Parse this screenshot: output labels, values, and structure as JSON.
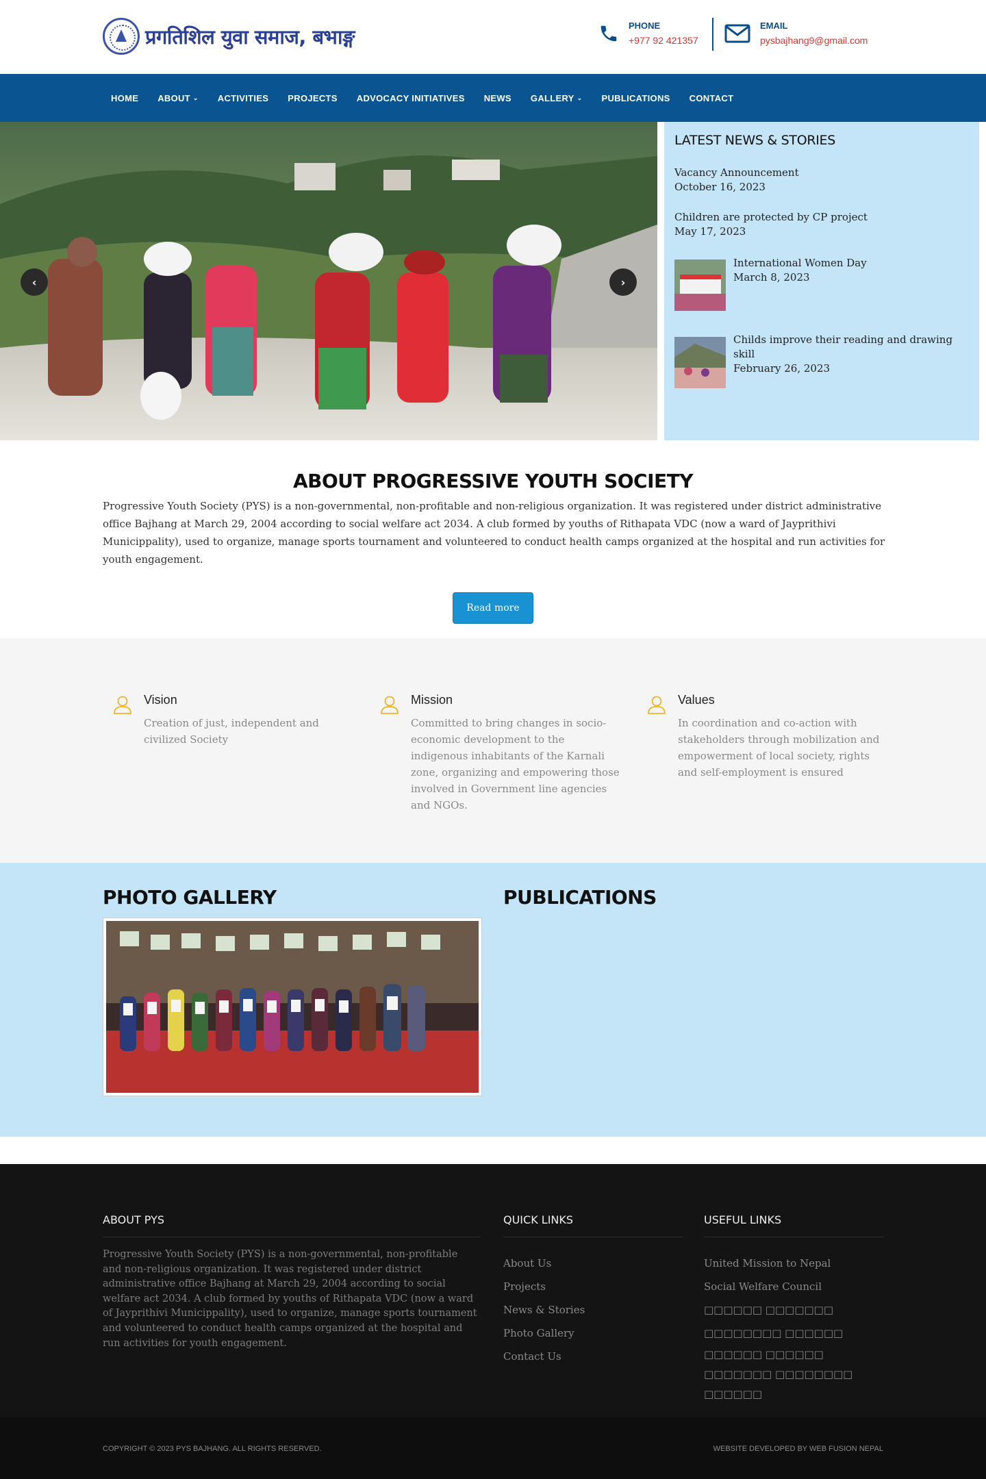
{
  "header": {
    "logo_text": "प्रगतिशिल युवा समाज, बभाङ्ग",
    "phone_label": "PHONE",
    "phone_value": "+977 92 421357",
    "email_label": "EMAIL",
    "email_value": "pysbajhang9@gmail.com"
  },
  "nav": {
    "items": [
      {
        "label": "HOME"
      },
      {
        "label": "ABOUT"
      },
      {
        "label": "ACTIVITIES"
      },
      {
        "label": "PROJECTS"
      },
      {
        "label": "ADVOCACY INITIATIVES"
      },
      {
        "label": "NEWS"
      },
      {
        "label": "GALLERY"
      },
      {
        "label": "PUBLICATIONS"
      },
      {
        "label": "CONTACT"
      }
    ]
  },
  "news": {
    "title": "LATEST NEWS & STORIES",
    "items": [
      {
        "title": "Vacancy Announcement",
        "date": "October 16, 2023"
      },
      {
        "title": "Children are protected by CP project",
        "date": "May 17, 2023"
      },
      {
        "title": "International Women Day",
        "date": "March 8, 2023"
      },
      {
        "title": "Childs improve their reading and drawing skill",
        "date": "February 26, 2023"
      }
    ]
  },
  "about": {
    "title": "ABOUT PROGRESSIVE YOUTH SOCIETY",
    "text": "Progressive Youth Society (PYS) is a non-governmental, non-profitable and non-religious organization. It was registered under district administrative office Bajhang at March 29, 2004 according to social welfare act 2034. A club formed by youths of Rithapata VDC (now a ward of Jayprithivi Municippality), used to organize, manage sports tournament and volunteered to conduct health camps organized at the hospital and run activities for youth engagement.",
    "button": "Read more"
  },
  "vmv": [
    {
      "title": "Vision",
      "text": "Creation of just, independent and civilized Society"
    },
    {
      "title": "Mission",
      "text": "Committed to bring changes in socio-economic development to the indigenous inhabitants of the Karnali zone, organizing and empowering those involved in Government line agencies and NGOs."
    },
    {
      "title": "Values",
      "text": "In coordination and co-action with stakeholders through mobilization and empowerment of local society, rights and self-employment is ensured"
    }
  ],
  "gallery": {
    "title": "PHOTO GALLERY"
  },
  "publications": {
    "title": "PUBLICATIONS"
  },
  "footer": {
    "about_title": "ABOUT PYS",
    "about_text": "Progressive Youth Society (PYS) is a non-governmental, non-profitable and non-religious organization. It was registered under district administrative office Bajhang at March 29, 2004 according to social welfare act 2034. A club formed by youths of Rithapata VDC (now a ward of Jayprithivi Municippality), used to organize, manage sports tournament and volunteered to conduct health camps organized at the hospital and run activities for youth engagement.",
    "quick_title": "QUICK LINKS",
    "quick_links": [
      "About Us",
      "Projects",
      "News & Stories",
      "Photo Gallery",
      "Contact Us"
    ],
    "useful_title": "USEFUL LINKS",
    "useful_links": [
      "United Mission to Nepal",
      "Social Welfare Council",
      "□□□□□□ □□□□□□□ □□□□□□□□ □□□□□□",
      "□□□□□□ □□□□□□ □□□□□□□ □□□□□□□□ □□□□□□"
    ],
    "copyright": "COPYRIGHT © 2023 PYS BAJHANG. ALL RIGHTS RESERVED.",
    "developer": "WEBSITE DEVELOPED BY WEB FUSION NEPAL"
  }
}
